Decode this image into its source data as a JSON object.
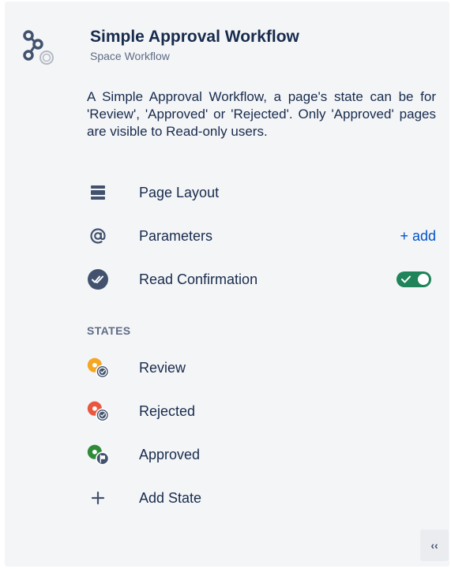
{
  "header": {
    "title": "Simple Approval Workflow",
    "subtitle": "Space Workflow",
    "icon": "workflow-nodes-icon"
  },
  "description": "A Simple Approval Workflow, a page's state can be for 'Review', 'Approved' or 'Rejected'. Only 'Approved' pages are visible to Read-only users.",
  "settings": [
    {
      "label": "Page Layout",
      "icon": "page-layout-icon"
    },
    {
      "label": "Parameters",
      "icon": "at-sign-icon",
      "action_label": "+ add"
    },
    {
      "label": "Read Confirmation",
      "icon": "read-confirmation-icon",
      "toggle_on": true
    }
  ],
  "states_heading": "STATES",
  "states": [
    {
      "label": "Review",
      "color": "#f5a623",
      "badge": "check-badge-icon"
    },
    {
      "label": "Rejected",
      "color": "#e9573f",
      "badge": "check-badge-icon"
    },
    {
      "label": "Approved",
      "color": "#2e8b3a",
      "badge": "flag-badge-icon"
    }
  ],
  "add_state_label": "Add State",
  "collapse_label": "‹‹",
  "colors": {
    "panel_bg": "#f4f5f7",
    "text": "#172b4d",
    "muted": "#5e6c84",
    "link": "#0052cc",
    "toggle_on": "#1f845a"
  }
}
